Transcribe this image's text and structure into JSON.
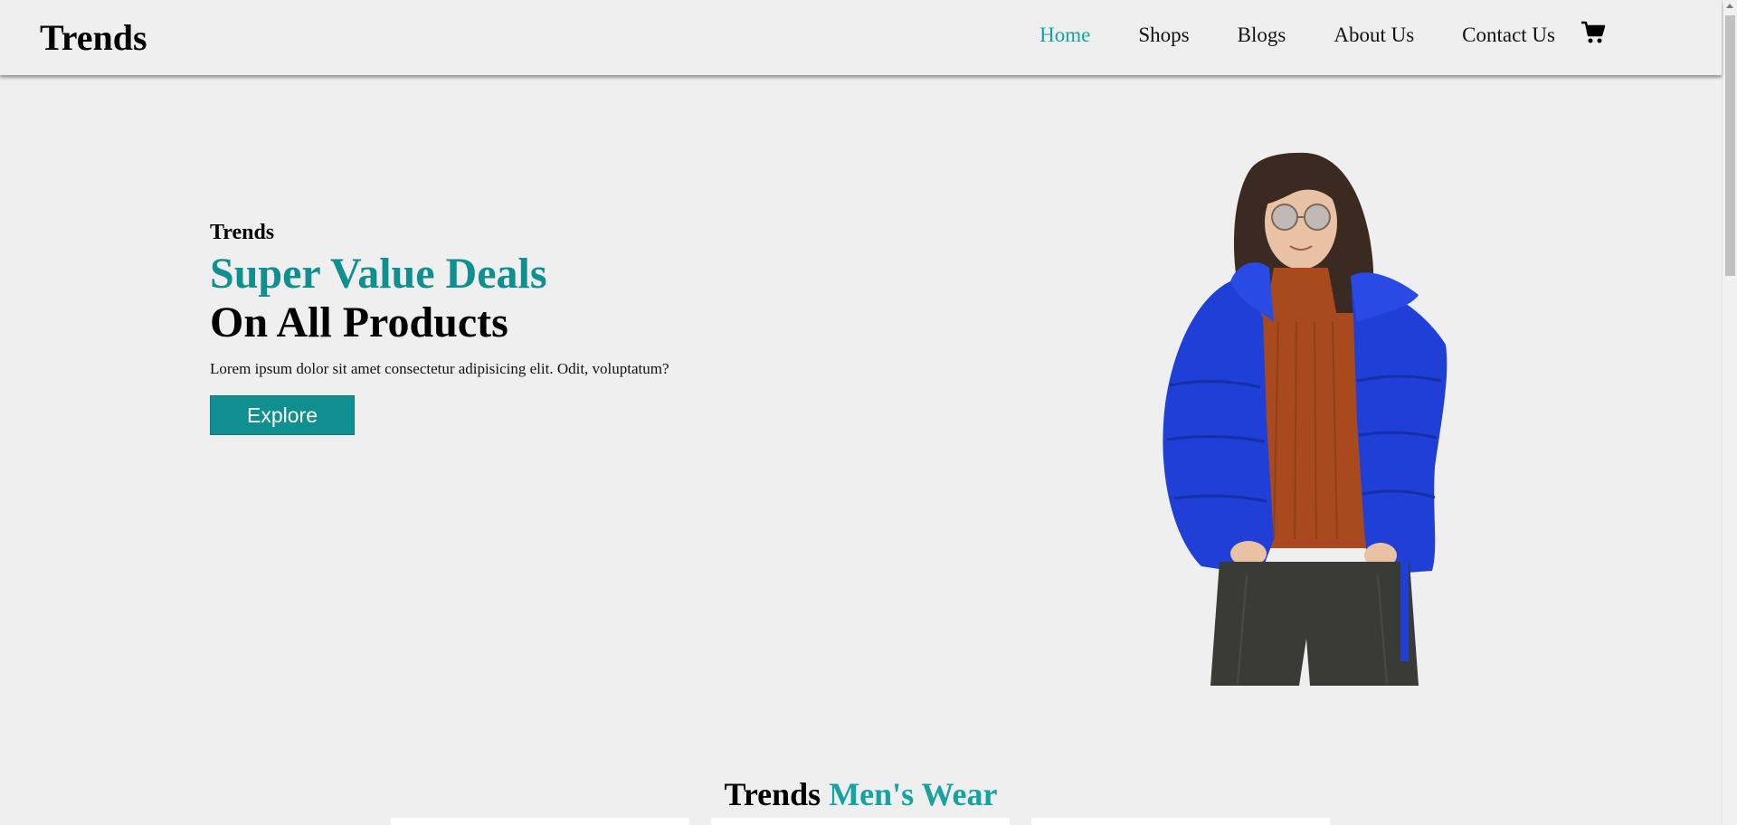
{
  "header": {
    "logo": "Trends",
    "nav": [
      {
        "label": "Home",
        "active": true
      },
      {
        "label": "Shops",
        "active": false
      },
      {
        "label": "Blogs",
        "active": false
      },
      {
        "label": "About Us",
        "active": false
      },
      {
        "label": "Contact Us",
        "active": false
      }
    ],
    "cart_icon": "shopping-cart-icon"
  },
  "hero": {
    "eyebrow": "Trends",
    "title_line1": "Super Value Deals",
    "title_line2": "On All Products",
    "description": "Lorem ipsum dolor sit amet consectetur adipisicing elit. Odit, voluptatum?",
    "cta_label": "Explore"
  },
  "section": {
    "title_prefix": "Trends",
    "title_accent": "Men's Wear"
  },
  "colors": {
    "accent": "#0f8f8f",
    "accent_light": "#17a2a2",
    "background": "#efefef",
    "jacket": "#1f3fd6",
    "sweater": "#a84a1e"
  }
}
